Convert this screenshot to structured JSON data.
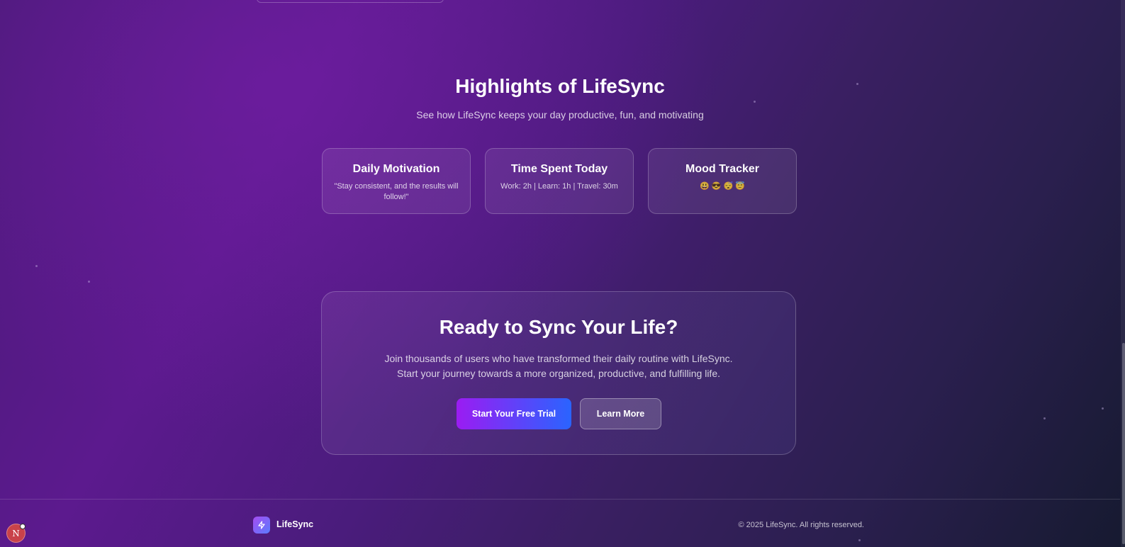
{
  "highlights": {
    "title": "Highlights of LifeSync",
    "subtitle": "See how LifeSync keeps your day productive, fun, and motivating",
    "cards": [
      {
        "title": "Daily Motivation",
        "text": "\"Stay consistent, and the results will follow!\""
      },
      {
        "title": "Time Spent Today",
        "text": "Work: 2h | Learn: 1h | Travel: 30m"
      },
      {
        "title": "Mood Tracker",
        "text": "😃 😎 😴 😇"
      }
    ]
  },
  "cta": {
    "title": "Ready to Sync Your Life?",
    "text_line1": "Join thousands of users who have transformed their daily routine with LifeSync.",
    "text_line2": "Start your journey towards a more organized, productive, and fulfilling life.",
    "primary_button": "Start Your Free Trial",
    "secondary_button": "Learn More"
  },
  "footer": {
    "brand": "LifeSync",
    "logo_icon": "lightning-icon",
    "copyright": "© 2025 LifeSync. All rights reserved."
  },
  "avatar": {
    "initial": "N"
  },
  "colors": {
    "button_gradient_start": "#9b1cf2",
    "button_gradient_end": "#2a64ff",
    "background_purple": "#5c1a8e",
    "background_dark": "#161a30"
  }
}
